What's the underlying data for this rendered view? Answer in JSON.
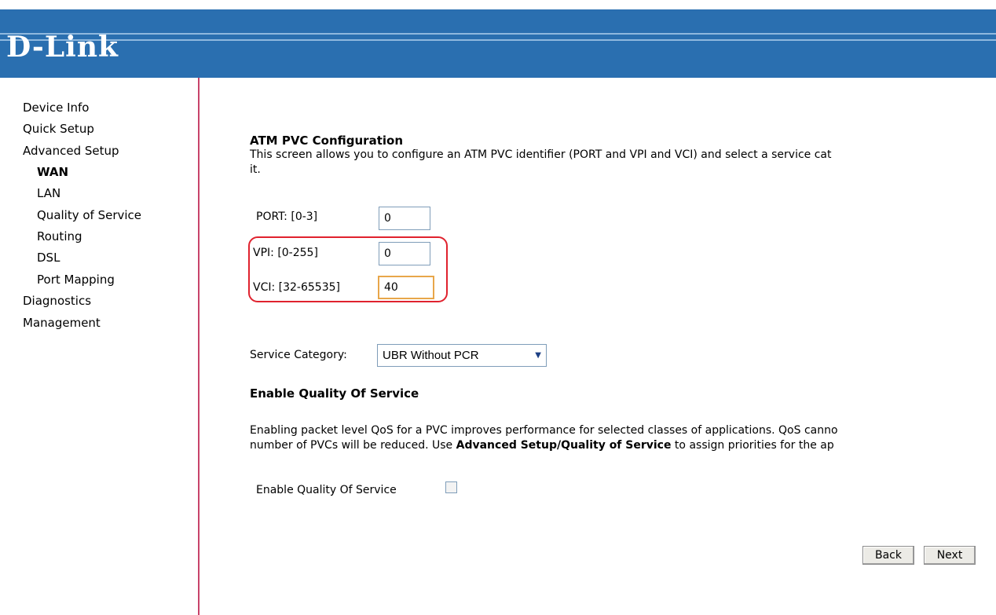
{
  "header": {
    "logo": "D-Link"
  },
  "sidebar": {
    "items": [
      {
        "label": "Device Info"
      },
      {
        "label": "Quick Setup"
      },
      {
        "label": "Advanced Setup"
      },
      {
        "label": "WAN"
      },
      {
        "label": "LAN"
      },
      {
        "label": "Quality of Service"
      },
      {
        "label": "Routing"
      },
      {
        "label": "DSL"
      },
      {
        "label": "Port Mapping"
      },
      {
        "label": "Diagnostics"
      },
      {
        "label": "Management"
      }
    ]
  },
  "main": {
    "title": "ATM PVC Configuration",
    "description_line1": "This screen allows you to configure an ATM PVC identifier (PORT and VPI and VCI) and select a service cat",
    "description_line2": "it.",
    "port_label": "PORT: [0-3]",
    "port_value": "0",
    "vpi_label": "VPI: [0-255]",
    "vpi_value": "0",
    "vci_label": "VCI: [32-65535]",
    "vci_value": "40",
    "service_label": "Service Category:",
    "service_value": "UBR Without PCR",
    "qos_heading": "Enable Quality Of Service",
    "qos_text_line1": "Enabling packet level QoS for a PVC improves performance for selected classes of applications.  QoS canno",
    "qos_text_line2_pre": "number of PVCs will be reduced. Use ",
    "qos_text_line2_bold": "Advanced Setup/Quality of Service",
    "qos_text_line2_post": " to assign priorities for the ap",
    "qos_checkbox_label": "Enable Quality Of Service",
    "back_label": "Back",
    "next_label": "Next"
  }
}
